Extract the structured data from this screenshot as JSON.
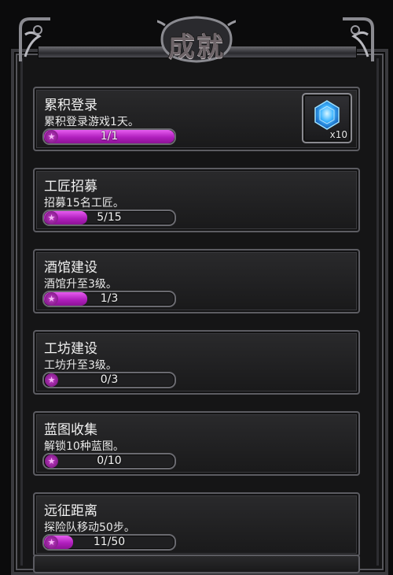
{
  "screen": {
    "title": "成就"
  },
  "achievements": [
    {
      "title": "累积登录",
      "desc": "累积登录游戏1天。",
      "progress_text": "1/1",
      "progress": 1.0,
      "reward": {
        "icon": "blue-crystal-icon",
        "qty": "x10"
      }
    },
    {
      "title": "工匠招募",
      "desc": "招募15名工匠。",
      "progress_text": "5/15",
      "progress": 0.333
    },
    {
      "title": "酒馆建设",
      "desc": "酒馆升至3级。",
      "progress_text": "1/3",
      "progress": 0.333
    },
    {
      "title": "工坊建设",
      "desc": "工坊升至3级。",
      "progress_text": "0/3",
      "progress": 0.0
    },
    {
      "title": "蓝图收集",
      "desc": "解锁10种蓝图。",
      "progress_text": "0/10",
      "progress": 0.0
    },
    {
      "title": "远征距离",
      "desc": "探险队移动50步。",
      "progress_text": "11/50",
      "progress": 0.22
    }
  ],
  "colors": {
    "progress_fill": "#b01fbd",
    "text": "#f2f2f2"
  }
}
